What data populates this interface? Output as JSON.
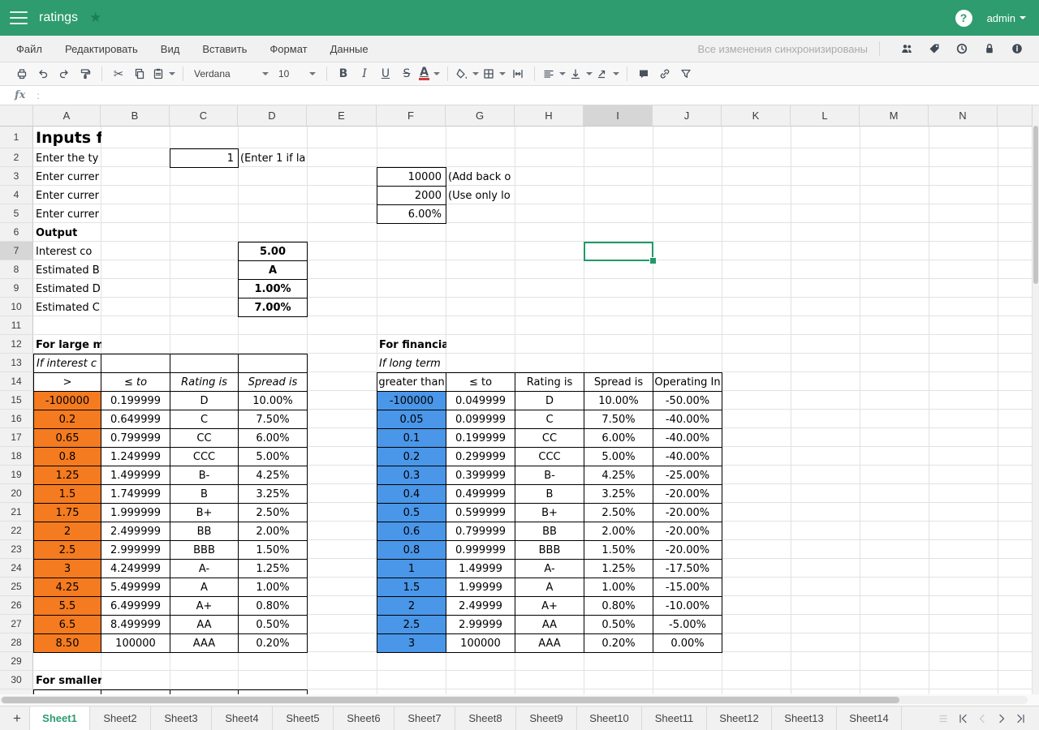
{
  "header": {
    "title": "ratings",
    "user_label": "admin",
    "help_glyph": "?",
    "star_icon": "star"
  },
  "menubar": {
    "items": [
      "Файл",
      "Редактировать",
      "Вид",
      "Вставить",
      "Формат",
      "Данные"
    ],
    "sync_status": "Все изменения синхронизированы",
    "icons": [
      "users",
      "tag",
      "version-history",
      "lock",
      "info"
    ]
  },
  "toolbar": {
    "font_name": "Verdana",
    "font_size": "10",
    "icons": [
      "print",
      "undo",
      "redo",
      "format-painter",
      "cut",
      "copy",
      "paste",
      "bold",
      "italic",
      "underline",
      "strikethrough",
      "font-color",
      "fill-color",
      "borders",
      "merge-cells",
      "align",
      "vertical-align",
      "text-orientation",
      "comment",
      "link",
      "filter"
    ]
  },
  "formula_bar": {
    "fx_label": "fx",
    "separator": ":",
    "value": ""
  },
  "grid": {
    "column_headers": [
      "A",
      "B",
      "C",
      "D",
      "E",
      "F",
      "G",
      "H",
      "I",
      "J",
      "K",
      "L",
      "M",
      "N"
    ],
    "rows_visible": 30,
    "selected_cell": {
      "column": "I",
      "row": 7
    },
    "cells": {
      "title": {
        "row": 1,
        "col": "A",
        "text": "Inputs f"
      },
      "inputs": [
        {
          "row": 2,
          "label": "Enter the ty",
          "value_col": "C",
          "value": "1",
          "note_col": "D",
          "note": "(Enter 1 if la"
        },
        {
          "row": 3,
          "label": "Enter currer",
          "value_col": "F",
          "value": "10000",
          "note_col": "G",
          "note": "(Add back o"
        },
        {
          "row": 4,
          "label": "Enter currer",
          "value_col": "F",
          "value": "2000",
          "note_col": "G",
          "note": "(Use only lo"
        },
        {
          "row": 5,
          "label": "Enter currer",
          "value_col": "F",
          "value": "6.00%",
          "note_col": "",
          "note": ""
        }
      ],
      "output_header": {
        "row": 6,
        "col": "A",
        "text": "Output"
      },
      "outputs": [
        {
          "row": 7,
          "label": "Interest  co",
          "value": "5.00"
        },
        {
          "row": 8,
          "label": "Estimated B",
          "value": "A"
        },
        {
          "row": 9,
          "label": "Estimated D",
          "value": "1.00%"
        },
        {
          "row": 10,
          "label": "Estimated C",
          "value": "7.00%"
        }
      ],
      "left_table": {
        "title_row": 12,
        "title": "For large m",
        "subtitle_row": 13,
        "subtitle": "If interest c",
        "header_row": 14,
        "start_col": "A",
        "headers": [
          ">",
          "≤ to",
          "Rating is",
          "Spread is"
        ],
        "first_data_row": 15,
        "rows": [
          [
            "-100000",
            "0.199999",
            "D",
            "10.00%"
          ],
          [
            "0.2",
            "0.649999",
            "C",
            "7.50%"
          ],
          [
            "0.65",
            "0.799999",
            "CC",
            "6.00%"
          ],
          [
            "0.8",
            "1.249999",
            "CCC",
            "5.00%"
          ],
          [
            "1.25",
            "1.499999",
            "B-",
            "4.25%"
          ],
          [
            "1.5",
            "1.749999",
            "B",
            "3.25%"
          ],
          [
            "1.75",
            "1.999999",
            "B+",
            "2.50%"
          ],
          [
            "2",
            "2.499999",
            "BB",
            "2.00%"
          ],
          [
            "2.5",
            "2.999999",
            "BBB",
            "1.50%"
          ],
          [
            "3",
            "4.249999",
            "A-",
            "1.25%"
          ],
          [
            "4.25",
            "5.499999",
            "A",
            "1.00%"
          ],
          [
            "5.5",
            "6.499999",
            "A+",
            "0.80%"
          ],
          [
            "6.5",
            "8.499999",
            "AA",
            "0.50%"
          ],
          [
            "8.50",
            "100000",
            "AAA",
            "0.20%"
          ]
        ]
      },
      "right_table": {
        "title_row": 12,
        "title": "For financia",
        "subtitle_row": 13,
        "subtitle": "If long term",
        "header_row": 14,
        "start_col": "F",
        "headers": [
          "greater than",
          "≤ to",
          "Rating is",
          "Spread is",
          "Operating In"
        ],
        "first_data_row": 15,
        "rows": [
          [
            "-100000",
            "0.049999",
            "D",
            "10.00%",
            "-50.00%"
          ],
          [
            "0.05",
            "0.099999",
            "C",
            "7.50%",
            "-40.00%"
          ],
          [
            "0.1",
            "0.199999",
            "CC",
            "6.00%",
            "-40.00%"
          ],
          [
            "0.2",
            "0.299999",
            "CCC",
            "5.00%",
            "-40.00%"
          ],
          [
            "0.3",
            "0.399999",
            "B-",
            "4.25%",
            "-25.00%"
          ],
          [
            "0.4",
            "0.499999",
            "B",
            "3.25%",
            "-20.00%"
          ],
          [
            "0.5",
            "0.599999",
            "B+",
            "2.50%",
            "-20.00%"
          ],
          [
            "0.6",
            "0.799999",
            "BB",
            "2.00%",
            "-20.00%"
          ],
          [
            "0.8",
            "0.999999",
            "BBB",
            "1.50%",
            "-20.00%"
          ],
          [
            "1",
            "1.49999",
            "A-",
            "1.25%",
            "-17.50%"
          ],
          [
            "1.5",
            "1.99999",
            "A",
            "1.00%",
            "-15.00%"
          ],
          [
            "2",
            "2.49999",
            "A+",
            "0.80%",
            "-10.00%"
          ],
          [
            "2.5",
            "2.99999",
            "AA",
            "0.50%",
            "-5.00%"
          ],
          [
            "3",
            "100000",
            "AAA",
            "0.20%",
            "0.00%"
          ]
        ]
      },
      "smaller_header": {
        "row": 30,
        "col": "A",
        "text": "For smaller"
      }
    }
  },
  "tabs": {
    "add_label": "+",
    "active": "Sheet1",
    "sheets": [
      "Sheet1",
      "Sheet2",
      "Sheet3",
      "Sheet4",
      "Sheet5",
      "Sheet6",
      "Sheet7",
      "Sheet8",
      "Sheet9",
      "Sheet10",
      "Sheet11",
      "Sheet12",
      "Sheet13",
      "Sheet14"
    ],
    "nav_icons": [
      "tab-list",
      "first-sheet",
      "previous-sheet",
      "next-sheet",
      "last-sheet"
    ]
  },
  "colors": {
    "brand_green": "#2e9c6e",
    "selection_green": "#1f9a68",
    "table_orange": "#f57b20",
    "table_blue": "#4a96e8"
  }
}
